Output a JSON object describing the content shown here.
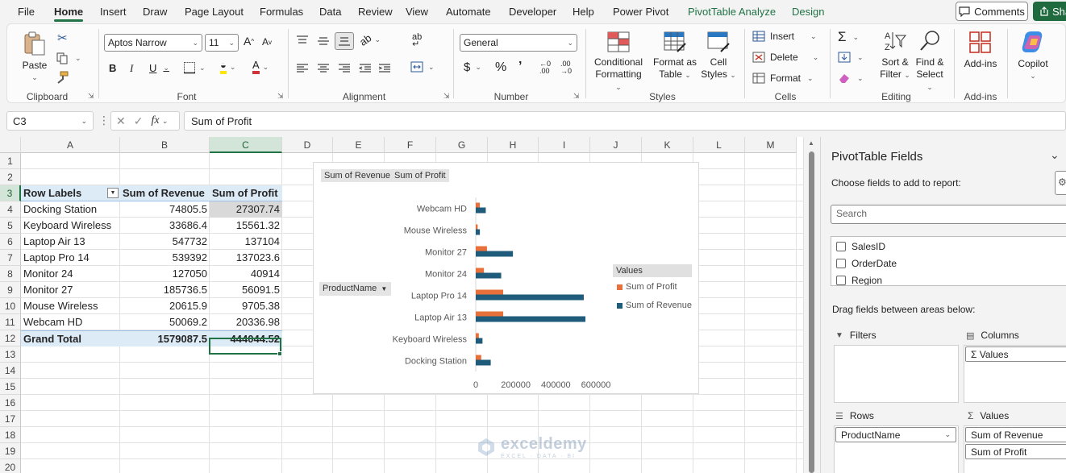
{
  "menu": {
    "tabs": [
      "File",
      "Home",
      "Insert",
      "Draw",
      "Page Layout",
      "Formulas",
      "Data",
      "Review",
      "View",
      "Automate",
      "Developer",
      "Help",
      "Power Pivot"
    ],
    "context_tabs": [
      "PivotTable Analyze",
      "Design"
    ],
    "active_tab": "Home",
    "comments_label": "Comments",
    "share_label": "Share"
  },
  "ribbon": {
    "clipboard": {
      "label": "Clipboard",
      "paste": "Paste"
    },
    "font": {
      "label": "Font",
      "font_name": "Aptos Narrow",
      "font_size": "11"
    },
    "alignment": {
      "label": "Alignment"
    },
    "number": {
      "label": "Number",
      "format": "General"
    },
    "styles": {
      "label": "Styles",
      "conditional": "Conditional",
      "formatting": "Formatting",
      "format_as": "Format as",
      "table": "Table",
      "cell": "Cell",
      "styles_btn": "Styles"
    },
    "cells": {
      "label": "Cells",
      "insert": "Insert",
      "delete": "Delete",
      "format": "Format"
    },
    "editing": {
      "label": "Editing",
      "sort": "Sort &",
      "filter": "Filter",
      "find": "Find &",
      "select": "Select"
    },
    "addins": {
      "label": "Add-ins",
      "btn": "Add-ins"
    },
    "copilot": {
      "label": "Copilot"
    }
  },
  "formula_bar": {
    "name_box": "C3",
    "fx": "fx",
    "formula": "Sum of Profit"
  },
  "sheet": {
    "columns": [
      "A",
      "B",
      "C",
      "D",
      "E",
      "F",
      "G",
      "H",
      "I",
      "J",
      "K",
      "L",
      "M"
    ],
    "rows": [
      "1",
      "2",
      "3",
      "4",
      "5",
      "6",
      "7",
      "8",
      "9",
      "10",
      "11",
      "12",
      "13",
      "14",
      "15",
      "16",
      "17",
      "18",
      "19",
      "20"
    ],
    "pivot": {
      "header": [
        "Row Labels",
        "Sum of Revenue",
        "Sum of Profit"
      ],
      "body": [
        [
          "Docking Station",
          "74805.5",
          "27307.74"
        ],
        [
          "Keyboard Wireless",
          "33686.4",
          "15561.32"
        ],
        [
          "Laptop Air 13",
          "547732",
          "137104"
        ],
        [
          "Laptop Pro 14",
          "539392",
          "137023.6"
        ],
        [
          "Monitor 24",
          "127050",
          "40914"
        ],
        [
          "Monitor 27",
          "185736.5",
          "56091.5"
        ],
        [
          "Mouse Wireless",
          "20615.9",
          "9705.38"
        ],
        [
          "Webcam HD",
          "50069.2",
          "20336.98"
        ]
      ],
      "total": [
        "Grand Total",
        "1579087.5",
        "444044.52"
      ]
    }
  },
  "chart_data": {
    "type": "bar",
    "orientation": "horizontal",
    "field_buttons": [
      "Sum of Revenue",
      "Sum of Profit"
    ],
    "axis_field_button": "ProductName",
    "categories": [
      "Docking Station",
      "Keyboard Wireless",
      "Laptop Air 13",
      "Laptop Pro 14",
      "Monitor 24",
      "Monitor 27",
      "Mouse Wireless",
      "Webcam HD"
    ],
    "series": [
      {
        "name": "Sum of Revenue",
        "color": "#1f5b7a",
        "values": [
          74805.5,
          33686.4,
          547732,
          539392,
          127050,
          185736.5,
          20615.9,
          50069.2
        ]
      },
      {
        "name": "Sum of Profit",
        "color": "#e8703a",
        "values": [
          27307.74,
          15561.32,
          137104,
          137023.6,
          40914,
          56091.5,
          9705.38,
          20336.98
        ]
      }
    ],
    "legend_title": "Values",
    "legend_position": "right",
    "xlim": [
      0,
      600000
    ],
    "xticks": [
      "0",
      "200000",
      "400000",
      "600000"
    ],
    "grid": false
  },
  "pane": {
    "title": "PivotTable Fields",
    "choose": "Choose fields to add to report:",
    "search_placeholder": "Search",
    "fields": [
      "SalesID",
      "OrderDate",
      "Region"
    ],
    "drag_text": "Drag fields between areas below:",
    "filters": "Filters",
    "columns": "Columns",
    "columns_item": "Values",
    "rows": "Rows",
    "rows_item": "ProductName",
    "values": "Values",
    "values_items": [
      "Sum of Revenue",
      "Sum of Profit"
    ]
  },
  "watermark": {
    "name": "exceldemy",
    "sub": "EXCEL · DATA · BI"
  }
}
